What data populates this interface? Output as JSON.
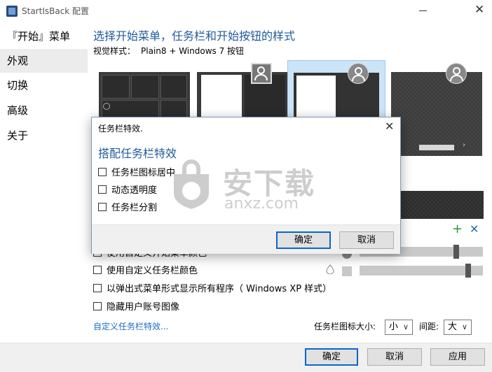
{
  "window": {
    "title": "StartIsBack 配置"
  },
  "sidebar": {
    "items": [
      {
        "label": "『开始』菜单"
      },
      {
        "label": "外观"
      },
      {
        "label": "切换"
      },
      {
        "label": "高级"
      },
      {
        "label": "关于"
      }
    ]
  },
  "main": {
    "heading": "选择开始菜单，任务栏和开始按钮的样式",
    "visual_style_label": "视觉样式：",
    "visual_style_value": "Plain8 + Windows 7 按钮",
    "options": [
      {
        "label": "使用自定义开始菜单颜色"
      },
      {
        "label": "使用自定义任务栏颜色"
      },
      {
        "label": "以弹出式菜单形式显示所有程序（ Windows XP 样式）"
      },
      {
        "label": "隐藏用户账号图像"
      }
    ],
    "custom_link": "自定义任务栏特效...",
    "icon_size_label": "任务栏图标大小:",
    "icon_size_value": "小",
    "spacing_label": "间距:",
    "spacing_value": "大"
  },
  "footer": {
    "ok": "确定",
    "cancel": "取消",
    "apply": "应用"
  },
  "modal": {
    "title": "任务栏特效.",
    "heading": "搭配任务栏特效",
    "options": [
      {
        "label": "任务栏图标居中"
      },
      {
        "label": "动态透明度"
      },
      {
        "label": "任务栏分割"
      }
    ],
    "ok": "确定",
    "cancel": "取消"
  },
  "watermark": {
    "text": "安下载",
    "sub": "anxz.com"
  },
  "colors": {
    "accent": "#1f5b9a",
    "link": "#1f6bc0",
    "selection": "#cce4f7",
    "primary_border": "#0a66c8"
  }
}
